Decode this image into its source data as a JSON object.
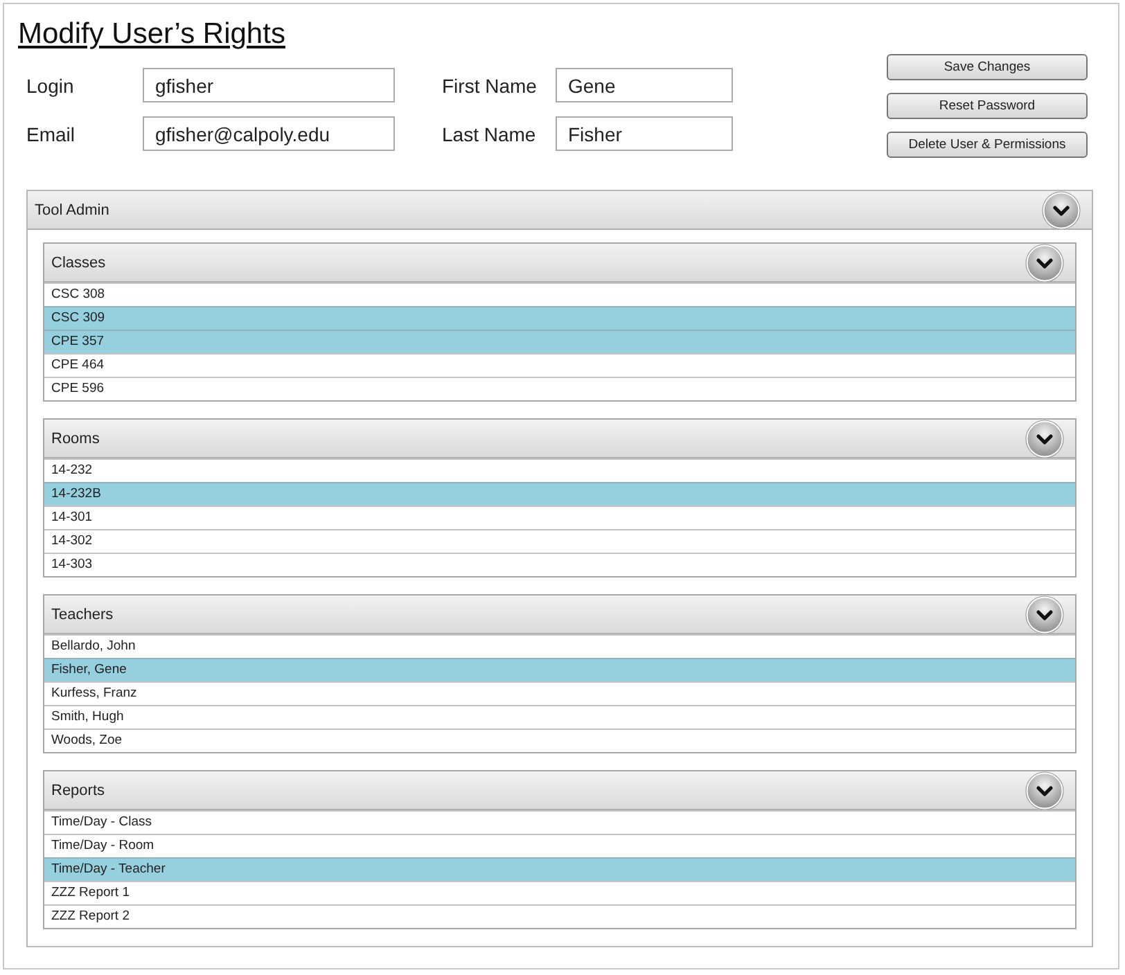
{
  "title": "Modify User’s Rights",
  "fields": [
    {
      "label": "Login",
      "value": "gfisher"
    },
    {
      "label": "First Name",
      "value": "Gene"
    },
    {
      "label": "Email",
      "value": "gfisher@calpoly.edu"
    },
    {
      "label": "Last Name",
      "value": "Fisher"
    }
  ],
  "buttons": [
    "Save Changes",
    "Reset Password",
    "Delete User & Permissions"
  ],
  "panel": {
    "title": "Tool Admin",
    "expanded": true,
    "sections": [
      {
        "title": "Classes",
        "expanded": true,
        "items": [
          {
            "label": "CSC 308",
            "selected": false
          },
          {
            "label": "CSC 309",
            "selected": true
          },
          {
            "label": "CPE 357",
            "selected": true
          },
          {
            "label": "CPE 464",
            "selected": false
          },
          {
            "label": "CPE 596",
            "selected": false
          }
        ]
      },
      {
        "title": "Rooms",
        "expanded": true,
        "items": [
          {
            "label": "14-232",
            "selected": false
          },
          {
            "label": "14-232B",
            "selected": true
          },
          {
            "label": "14-301",
            "selected": false
          },
          {
            "label": "14-302",
            "selected": false
          },
          {
            "label": "14-303",
            "selected": false
          }
        ]
      },
      {
        "title": "Teachers",
        "expanded": true,
        "items": [
          {
            "label": "Bellardo, John",
            "selected": false
          },
          {
            "label": "Fisher, Gene",
            "selected": true
          },
          {
            "label": "Kurfess, Franz",
            "selected": false
          },
          {
            "label": "Smith, Hugh",
            "selected": false
          },
          {
            "label": "Woods, Zoe",
            "selected": false
          }
        ]
      },
      {
        "title": "Reports",
        "expanded": true,
        "items": [
          {
            "label": "Time/Day - Class",
            "selected": false
          },
          {
            "label": "Time/Day - Room",
            "selected": false
          },
          {
            "label": "Time/Day - Teacher",
            "selected": true
          },
          {
            "label": "ZZZ Report 1",
            "selected": false
          },
          {
            "label": "ZZZ Report 2",
            "selected": false
          }
        ]
      }
    ]
  }
}
